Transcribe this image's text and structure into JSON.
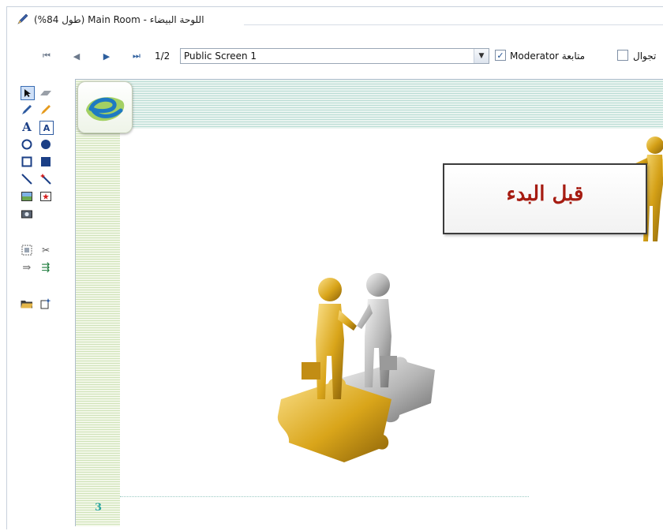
{
  "window": {
    "title": "اللوحة البيضاء - Main Room (طول 84%)",
    "title_icon": "pen-icon"
  },
  "toolbar": {
    "nav": [
      {
        "name": "first-page-button",
        "icon": "first-icon",
        "glyph": "⏮"
      },
      {
        "name": "prev-page-button",
        "icon": "prev-icon",
        "glyph": "◀"
      },
      {
        "name": "next-page-button",
        "icon": "next-icon",
        "glyph": "▶"
      },
      {
        "name": "last-page-button",
        "icon": "last-icon",
        "glyph": "⏭"
      }
    ],
    "page_indicator": "1/2",
    "screen_select": {
      "value": "Public Screen 1"
    },
    "moderator_checkbox": {
      "label": "Moderator متابعة",
      "checked": true
    },
    "roaming_checkbox": {
      "label": "تجوال",
      "checked": false
    }
  },
  "tools": [
    {
      "name": "select-tool",
      "icon": "arrow-icon"
    },
    {
      "name": "eraser-tool",
      "icon": "eraser-icon"
    },
    {
      "name": "pen-tool",
      "icon": "pen-icon"
    },
    {
      "name": "highlighter-tool",
      "icon": "highlighter-icon"
    },
    {
      "name": "text-tool",
      "icon": "text-icon",
      "label": "A"
    },
    {
      "name": "textbox-tool",
      "icon": "textbox-icon",
      "label": "A"
    },
    {
      "name": "ellipse-outline-tool",
      "icon": "circle-outline-icon"
    },
    {
      "name": "ellipse-filled-tool",
      "icon": "circle-filled-icon"
    },
    {
      "name": "rect-outline-tool",
      "icon": "square-outline-icon"
    },
    {
      "name": "rect-filled-tool",
      "icon": "square-filled-icon"
    },
    {
      "name": "line-tool",
      "icon": "line-icon"
    },
    {
      "name": "magic-wand-tool",
      "icon": "magic-wand-icon"
    },
    {
      "name": "insert-image-tool",
      "icon": "image-icon"
    },
    {
      "name": "insert-clipart-tool",
      "icon": "clipart-icon"
    },
    {
      "name": "snapshot-tool",
      "icon": "camera-icon"
    },
    {
      "name": "select-all-tool",
      "icon": "select-area-icon"
    },
    {
      "name": "delete-tool",
      "icon": "cut-icon"
    },
    {
      "name": "undo-tool",
      "icon": "undo-icon"
    },
    {
      "name": "redo-tool",
      "icon": "redo-icon"
    },
    {
      "name": "open-file-tool",
      "icon": "folder-icon"
    },
    {
      "name": "new-page-tool",
      "icon": "new-page-icon"
    }
  ],
  "slide": {
    "sign_text": "قبل البدء",
    "page_number": "3"
  },
  "colors": {
    "accent": "#2e5f9e",
    "sign_text": "#a61c12",
    "page_number": "#2aa6a0",
    "gold": "#d4a017"
  }
}
